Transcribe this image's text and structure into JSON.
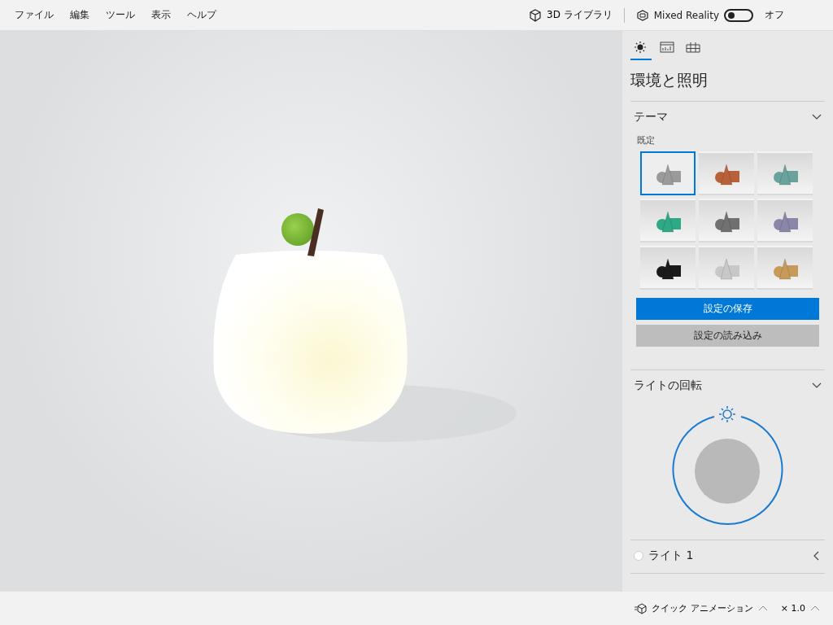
{
  "menu": [
    "ファイル",
    "編集",
    "ツール",
    "表示",
    "ヘルプ"
  ],
  "toolbar": {
    "library": "3D ライブラリ",
    "mixed_reality": {
      "label": "Mixed Reality",
      "on": false,
      "state_text": "オフ"
    }
  },
  "panel": {
    "tabs": [
      {
        "kind": "lighting",
        "selected": true
      },
      {
        "kind": "stats",
        "selected": false
      },
      {
        "kind": "grid",
        "selected": false
      }
    ],
    "title": "環境と照明",
    "theme": {
      "heading": "テーマ",
      "expanded": true,
      "subheading": "既定",
      "themes": [
        {
          "color": "#9a9a9a",
          "selected": true
        },
        {
          "color": "#b8603a",
          "selected": false
        },
        {
          "color": "#6aa39c",
          "selected": false
        },
        {
          "color": "#2fa886",
          "selected": false
        },
        {
          "color": "#707070",
          "selected": false
        },
        {
          "color": "#8a86a8",
          "selected": false
        },
        {
          "color": "#1a1a1a",
          "selected": false
        },
        {
          "color": "#c8c8c8",
          "selected": false
        },
        {
          "color": "#c89a5a",
          "selected": false
        }
      ],
      "save_button": "設定の保存",
      "load_button": "設定の読み込み"
    },
    "light_rotation": {
      "heading": "ライトの回転",
      "expanded": true
    },
    "lights": [
      {
        "label": "ライト 1",
        "expanded": false
      }
    ]
  },
  "status_bar": {
    "animation": "クイック アニメーション",
    "speed": "× 1.0"
  }
}
